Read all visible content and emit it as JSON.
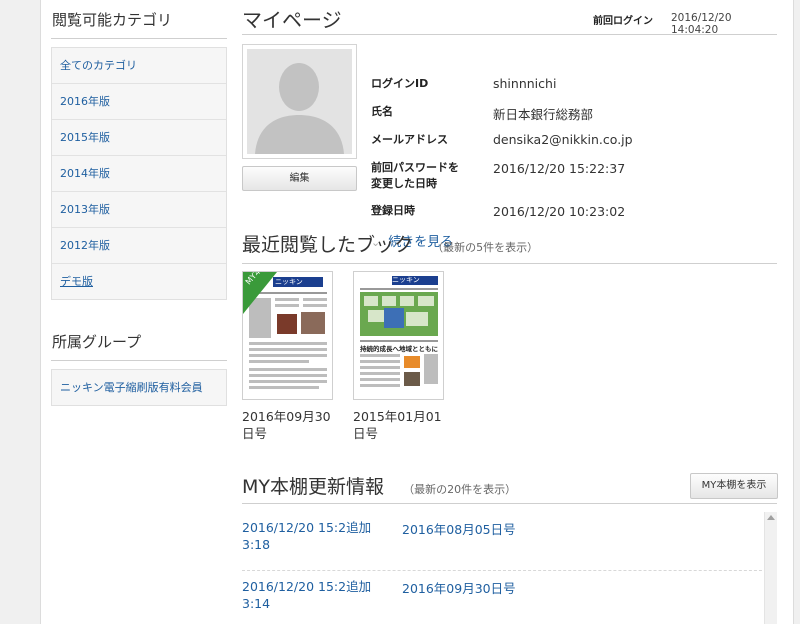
{
  "sidebar": {
    "categories_title": "閲覧可能カテゴリ",
    "categories": [
      {
        "label": "全てのカテゴリ"
      },
      {
        "label": "2016年版"
      },
      {
        "label": "2015年版"
      },
      {
        "label": "2014年版"
      },
      {
        "label": "2013年版"
      },
      {
        "label": "2012年版"
      },
      {
        "label": "デモ版"
      }
    ],
    "group_title": "所属グループ",
    "groups": [
      {
        "label": "ニッキン電子縮刷版有料会員"
      }
    ]
  },
  "header": {
    "title": "マイページ",
    "last_login_label": "前回ログイン",
    "last_login_value": "2016/12/20 14:04:20"
  },
  "profile": {
    "edit_label": "編集",
    "fields": [
      {
        "label": "ログインID",
        "value": "shinnnichi"
      },
      {
        "label": "氏名",
        "value": "新日本銀行総務部"
      },
      {
        "label": "メールアドレス",
        "value": "densika2@nikkin.co.jp"
      },
      {
        "label": "前回パスワードを\n変更した日時",
        "label_line1": "前回パスワードを",
        "label_line2": "変更した日時",
        "value": "2016/12/20 15:22:37"
      },
      {
        "label": "登録日時",
        "value": "2016/12/20 10:23:02"
      }
    ],
    "more_label": "続きを見る"
  },
  "recent": {
    "title": "最近閲覧したブック",
    "note": "（最新の5件を表示）",
    "books": [
      {
        "date_line1": "2016年09月30",
        "date_line2": "日号",
        "badge": "MY本棚",
        "masthead": "ニッキン"
      },
      {
        "date_line1": "2015年01月01",
        "date_line2": "日号",
        "masthead": "ニッキン",
        "headline": "持続的成長へ地域とともに"
      }
    ]
  },
  "shelf": {
    "title": "MY本棚更新情報",
    "note": "（最新の20件を表示）",
    "show_button": "MY本棚を表示",
    "updates": [
      {
        "time_line1": "2016/12/20 15:2",
        "action": "追加",
        "time_line2": "3:18",
        "book": "2016年08月05日号"
      },
      {
        "time_line1": "2016/12/20 15:2",
        "action": "追加",
        "time_line2": "3:14",
        "book": "2016年09月30日号"
      }
    ]
  },
  "colors": {
    "link": "#1f5fa0",
    "badge_green": "#3a9a3a"
  }
}
